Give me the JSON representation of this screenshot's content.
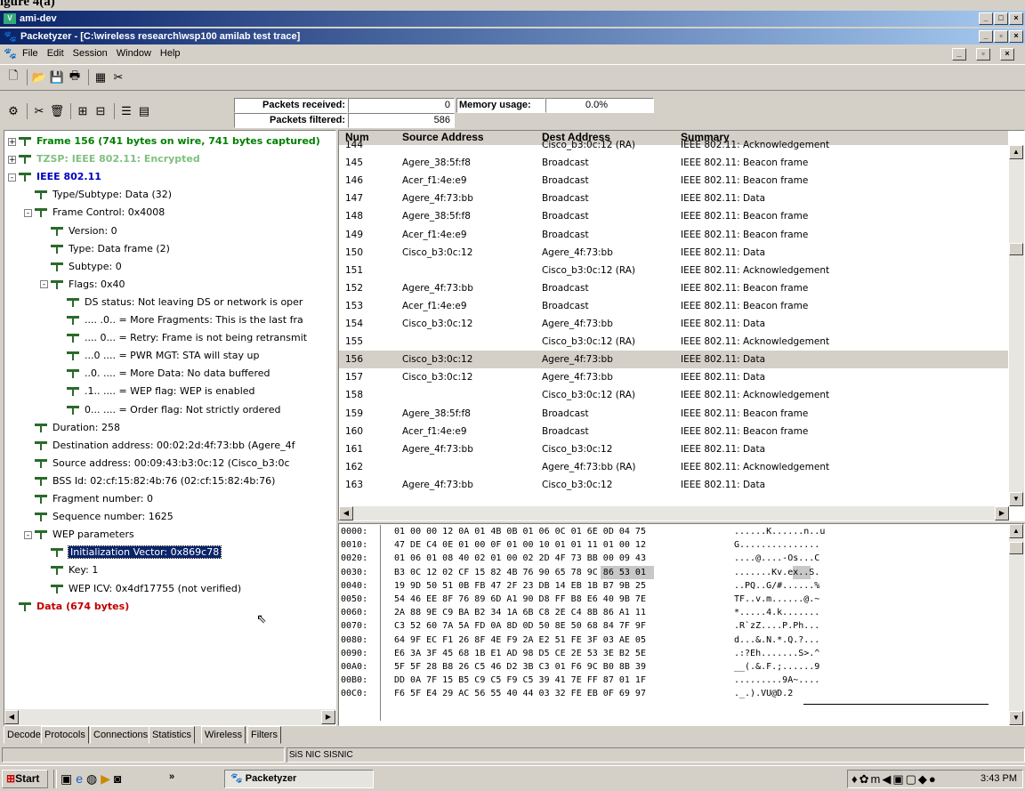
{
  "caption": "igure 4(a)",
  "outer_window": {
    "title": "ami-dev",
    "app_icon": "vnc-icon"
  },
  "app_window": {
    "title": "Packetyzer - [C:\\wireless research\\wsp100 amilab test trace]"
  },
  "menu": [
    "File",
    "Edit",
    "Session",
    "Window",
    "Help"
  ],
  "stats": {
    "received_label": "Packets received:",
    "received_value": "0",
    "filtered_label": "Packets filtered:",
    "filtered_value": "586",
    "memory_label": "Memory usage:",
    "memory_value": "0.0%"
  },
  "tree": [
    {
      "label": "Frame 156 (741 bytes on wire, 741 bytes captured)",
      "color": "#008000",
      "bold": true,
      "expander": "+",
      "indent": 0
    },
    {
      "label": "TZSP: IEEE 802.11: Encrypted",
      "color": "#80c080",
      "bold": true,
      "expander": "+",
      "indent": 0
    },
    {
      "label": "IEEE 802.11",
      "color": "#0000c0",
      "bold": true,
      "expander": "-",
      "indent": 0
    },
    {
      "label": "Type/Subtype: Data (32)",
      "indent": 1
    },
    {
      "label": "Frame Control: 0x4008",
      "expander": "-",
      "indent": 1
    },
    {
      "label": "Version: 0",
      "indent": 2
    },
    {
      "label": "Type: Data frame (2)",
      "indent": 2
    },
    {
      "label": "Subtype: 0",
      "indent": 2
    },
    {
      "label": "Flags: 0x40",
      "expander": "-",
      "indent": 2
    },
    {
      "label": "DS status: Not leaving DS or network is oper",
      "indent": 3
    },
    {
      "label": ".... .0.. = More Fragments: This is the last fra",
      "indent": 3
    },
    {
      "label": ".... 0... = Retry: Frame is not being retransmit",
      "indent": 3
    },
    {
      "label": "...0 .... = PWR MGT: STA will stay up",
      "indent": 3
    },
    {
      "label": "..0. .... = More Data: No data buffered",
      "indent": 3
    },
    {
      "label": ".1.. .... = WEP flag: WEP is enabled",
      "indent": 3
    },
    {
      "label": "0... .... = Order flag: Not strictly ordered",
      "indent": 3
    },
    {
      "label": "Duration: 258",
      "indent": 1
    },
    {
      "label": "Destination address: 00:02:2d:4f:73:bb (Agere_4f",
      "indent": 1
    },
    {
      "label": "Source address: 00:09:43:b3:0c:12 (Cisco_b3:0c",
      "indent": 1
    },
    {
      "label": "BSS Id: 02:cf:15:82:4b:76 (02:cf:15:82:4b:76)",
      "indent": 1
    },
    {
      "label": "Fragment number: 0",
      "indent": 1
    },
    {
      "label": "Sequence number: 1625",
      "indent": 1
    },
    {
      "label": "WEP parameters",
      "expander": "-",
      "indent": 1
    },
    {
      "label": "Initialization Vector: 0x869c78",
      "indent": 2,
      "selected": true
    },
    {
      "label": "Key: 1",
      "indent": 2
    },
    {
      "label": "WEP ICV: 0x4df17755 (not verified)",
      "indent": 2
    },
    {
      "label": "Data (674 bytes)",
      "color": "#c00000",
      "bold": true,
      "indent": 0
    }
  ],
  "packet_columns": [
    "Num",
    "Source Address",
    "Dest Address",
    "Summary"
  ],
  "packets": [
    {
      "num": "144",
      "src": "",
      "dst": "Cisco_b3:0c:12 (RA)",
      "summary": "IEEE 802.11: Acknowledgement"
    },
    {
      "num": "145",
      "src": "Agere_38:5f:f8",
      "dst": "Broadcast",
      "summary": "IEEE 802.11: Beacon frame"
    },
    {
      "num": "146",
      "src": "Acer_f1:4e:e9",
      "dst": "Broadcast",
      "summary": "IEEE 802.11: Beacon frame"
    },
    {
      "num": "147",
      "src": "Agere_4f:73:bb",
      "dst": "Broadcast",
      "summary": "IEEE 802.11: Data"
    },
    {
      "num": "148",
      "src": "Agere_38:5f:f8",
      "dst": "Broadcast",
      "summary": "IEEE 802.11: Beacon frame"
    },
    {
      "num": "149",
      "src": "Acer_f1:4e:e9",
      "dst": "Broadcast",
      "summary": "IEEE 802.11: Beacon frame"
    },
    {
      "num": "150",
      "src": "Cisco_b3:0c:12",
      "dst": "Agere_4f:73:bb",
      "summary": "IEEE 802.11: Data"
    },
    {
      "num": "151",
      "src": "",
      "dst": "Cisco_b3:0c:12 (RA)",
      "summary": "IEEE 802.11: Acknowledgement"
    },
    {
      "num": "152",
      "src": "Agere_4f:73:bb",
      "dst": "Broadcast",
      "summary": "IEEE 802.11: Beacon frame"
    },
    {
      "num": "153",
      "src": "Acer_f1:4e:e9",
      "dst": "Broadcast",
      "summary": "IEEE 802.11: Beacon frame"
    },
    {
      "num": "154",
      "src": "Cisco_b3:0c:12",
      "dst": "Agere_4f:73:bb",
      "summary": "IEEE 802.11: Data"
    },
    {
      "num": "155",
      "src": "",
      "dst": "Cisco_b3:0c:12 (RA)",
      "summary": "IEEE 802.11: Acknowledgement"
    },
    {
      "num": "156",
      "src": "Cisco_b3:0c:12",
      "dst": "Agere_4f:73:bb",
      "summary": "IEEE 802.11: Data",
      "selected": true
    },
    {
      "num": "157",
      "src": "Cisco_b3:0c:12",
      "dst": "Agere_4f:73:bb",
      "summary": "IEEE 802.11: Data"
    },
    {
      "num": "158",
      "src": "",
      "dst": "Cisco_b3:0c:12 (RA)",
      "summary": "IEEE 802.11: Acknowledgement"
    },
    {
      "num": "159",
      "src": "Agere_38:5f:f8",
      "dst": "Broadcast",
      "summary": "IEEE 802.11: Beacon frame"
    },
    {
      "num": "160",
      "src": "Acer_f1:4e:e9",
      "dst": "Broadcast",
      "summary": "IEEE 802.11: Beacon frame"
    },
    {
      "num": "161",
      "src": "Agere_4f:73:bb",
      "dst": "Cisco_b3:0c:12",
      "summary": "IEEE 802.11: Data"
    },
    {
      "num": "162",
      "src": "",
      "dst": "Agere_4f:73:bb (RA)",
      "summary": "IEEE 802.11: Acknowledgement"
    },
    {
      "num": "163",
      "src": "Agere_4f:73:bb",
      "dst": "Cisco_b3:0c:12",
      "summary": "IEEE 802.11: Data"
    }
  ],
  "hex_rows": [
    {
      "off": "0000:",
      "hex": "01 00 00 12 0A 01 4B 0B 01 06 0C 01 6E 0D 04 75",
      "ascii": "......K......n..u"
    },
    {
      "off": "0010:",
      "hex": "47 DE C4 0E 01 00 0F 01 00 10 01 01 11 01 00 12",
      "ascii": "G..............."
    },
    {
      "off": "0020:",
      "hex": "01 06 01 08 40 02 01 00 02 2D 4F 73 BB 00 09 43",
      "ascii": "....@....-Os...C"
    },
    {
      "off": "0030:",
      "hex": "B3 0C 12 02 CF 15 82 4B 76 90 65 78 9C 86 53 01",
      "ascii": ".......Kv.ex..S."
    },
    {
      "off": "0040:",
      "hex": "19 9D 50 51 0B FB 47 2F 23 DB 14 EB 1B B7 9B 25",
      "ascii": "..PQ..G/#......%"
    },
    {
      "off": "0050:",
      "hex": "54 46 EE 8F 76 89 6D A1 90 D8 FF B8 E6 40 9B 7E",
      "ascii": "TF..v.m......@.~"
    },
    {
      "off": "0060:",
      "hex": "2A 88 9E C9 BA B2 34 1A 6B C8 2E C4 8B 86 A1 11",
      "ascii": "*.....4.k......."
    },
    {
      "off": "0070:",
      "hex": "C3 52 60 7A 5A FD 0A 8D 0D 50 8E 50 68 84 7F 9F",
      "ascii": ".R`zZ....P.Ph..."
    },
    {
      "off": "0080:",
      "hex": "64 9F EC F1 26 8F 4E F9 2A E2 51 FE 3F 03 AE 05",
      "ascii": "d...&.N.*.Q.?..."
    },
    {
      "off": "0090:",
      "hex": "E6 3A 3F 45 68 1B E1 AD 98 D5 CE 2E 53 3E B2 5E",
      "ascii": ".:?Eh.......S>.^"
    },
    {
      "off": "00A0:",
      "hex": "5F 5F 28 B8 26 C5 46 D2 3B C3 01 F6 9C B0 8B 39",
      "ascii": "__(.&.F.;......9"
    },
    {
      "off": "00B0:",
      "hex": "DD 0A 7F 15 B5 C9 C5 F9 C5 39 41 7E FF 87 01 1F",
      "ascii": ".........9A~...."
    },
    {
      "off": "00C0:",
      "hex": "F6 5F E4 29 AC 56 55 40 44 03 32 FE EB 0F 69 97",
      "ascii": "._.).VU@D.2"
    }
  ],
  "tabs": [
    "Decode",
    "Protocols",
    "Connections",
    "Statistics",
    "Wireless",
    "Filters"
  ],
  "statusbar": {
    "text": "SiS NIC SISNIC"
  },
  "taskbar": {
    "start": "Start",
    "task": "Packetyzer",
    "clock": "3:43 PM",
    "chevrons": "»"
  },
  "colors": {
    "title_active": "#0a246a",
    "selection": "#0a246a",
    "row_selected": "#d4d0c8",
    "desktop": "#d4d0c8"
  }
}
